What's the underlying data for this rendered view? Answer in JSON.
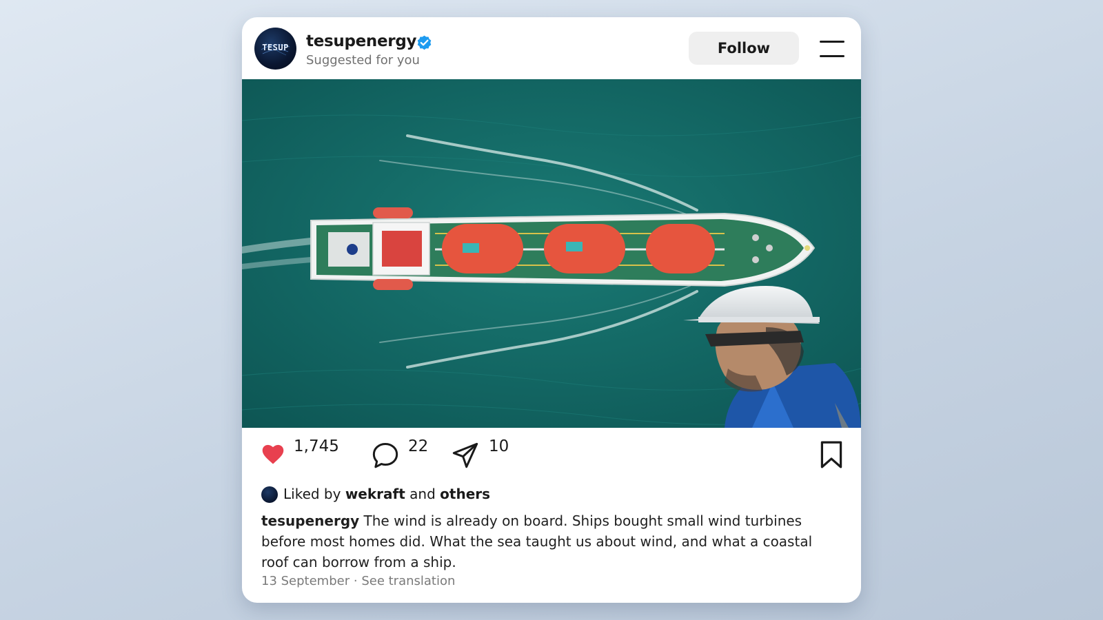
{
  "post": {
    "username": "tesupenergy",
    "subtitle": "Suggested for you",
    "avatar_text": "TESUP",
    "follow_label": "Follow",
    "likes": "1,745",
    "comments": "22",
    "shares": "10",
    "liked_by_prefix": "Liked by",
    "liked_by_user": "wekraft",
    "liked_by_and": "and",
    "liked_by_others": "others",
    "caption_user": "tesupenergy",
    "caption_text": "The wind is already on board. Ships bought small wind turbines before most homes did. What the sea taught us about wind, and what a coastal roof can borrow from a ship.",
    "date": "13 September",
    "separator": "·",
    "translation_link": "See translation"
  },
  "icons": {
    "verified": "verified-badge-icon",
    "menu": "hamburger-menu-icon",
    "like": "heart-icon",
    "comment": "comment-icon",
    "share": "send-icon",
    "save": "bookmark-icon"
  },
  "colors": {
    "heart": "#e8404f",
    "verified": "#1d9bf0",
    "sea": "#146a68",
    "follow_bg": "#efefef"
  }
}
